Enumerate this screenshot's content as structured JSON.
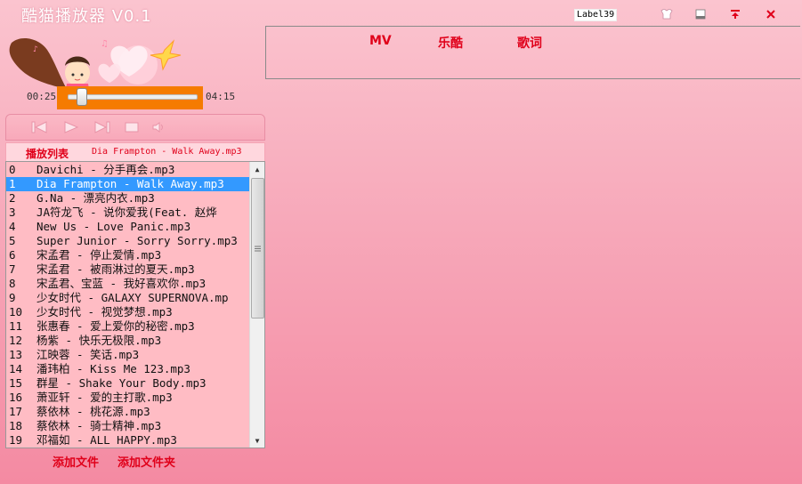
{
  "window": {
    "title": "酷猫播放器 V0.1",
    "label": "Label39",
    "controls": [
      "skin-icon",
      "minimize-icon",
      "pin-icon",
      "close-icon"
    ]
  },
  "player": {
    "elapsed": "00:25",
    "duration": "04:15",
    "progress": 0.1
  },
  "transport": {
    "buttons": [
      "previous-icon",
      "play-icon",
      "next-icon",
      "stop-icon",
      "volume-icon"
    ]
  },
  "playlist": {
    "title": "播放列表",
    "now_playing": "Dia Frampton - Walk Away.mp3",
    "items": [
      {
        "num": "0",
        "name": "Davichi - 分手再会.mp3"
      },
      {
        "num": "1",
        "name": "Dia Frampton - Walk Away.mp3"
      },
      {
        "num": "2",
        "name": "G.Na - 漂亮内衣.mp3"
      },
      {
        "num": "3",
        "name": "JA符龙飞 - 说你爱我(Feat. 赵烨"
      },
      {
        "num": "4",
        "name": "New Us - Love Panic.mp3"
      },
      {
        "num": "5",
        "name": "Super Junior - Sorry Sorry.mp3"
      },
      {
        "num": "6",
        "name": "宋孟君 - 停止爱情.mp3"
      },
      {
        "num": "7",
        "name": "宋孟君 - 被雨淋过的夏天.mp3"
      },
      {
        "num": "8",
        "name": "宋孟君、宝蓝 - 我好喜欢你.mp3"
      },
      {
        "num": "9",
        "name": "少女时代 - GALAXY SUPERNOVA.mp"
      },
      {
        "num": "10",
        "name": " 少女时代 - 视觉梦想.mp3"
      },
      {
        "num": "11",
        "name": " 张惠春 - 爱上爱你的秘密.mp3"
      },
      {
        "num": "12",
        "name": " 杨紫 - 快乐无极限.mp3"
      },
      {
        "num": "13",
        "name": " 江映蓉 - 笑话.mp3"
      },
      {
        "num": "14",
        "name": " 潘玮柏 - Kiss Me 123.mp3"
      },
      {
        "num": "15",
        "name": " 群星 - Shake Your Body.mp3"
      },
      {
        "num": "16",
        "name": " 萧亚轩 - 爱的主打歌.mp3"
      },
      {
        "num": "17",
        "name": " 蔡依林 - 桃花源.mp3"
      },
      {
        "num": "18",
        "name": " 蔡依林 - 骑士精神.mp3"
      },
      {
        "num": "19",
        "name": " 邓福如 - ALL HAPPY.mp3"
      }
    ],
    "selected_index": 1
  },
  "actions": {
    "add_file": "添加文件",
    "add_folder": "添加文件夹"
  },
  "tabs": [
    "MV",
    "乐酷",
    "歌词"
  ],
  "colors": {
    "accent": "#e0001a",
    "progress_bg": "#f57b00",
    "selection": "#3399ff",
    "list_bg": "#ffbcc4"
  }
}
